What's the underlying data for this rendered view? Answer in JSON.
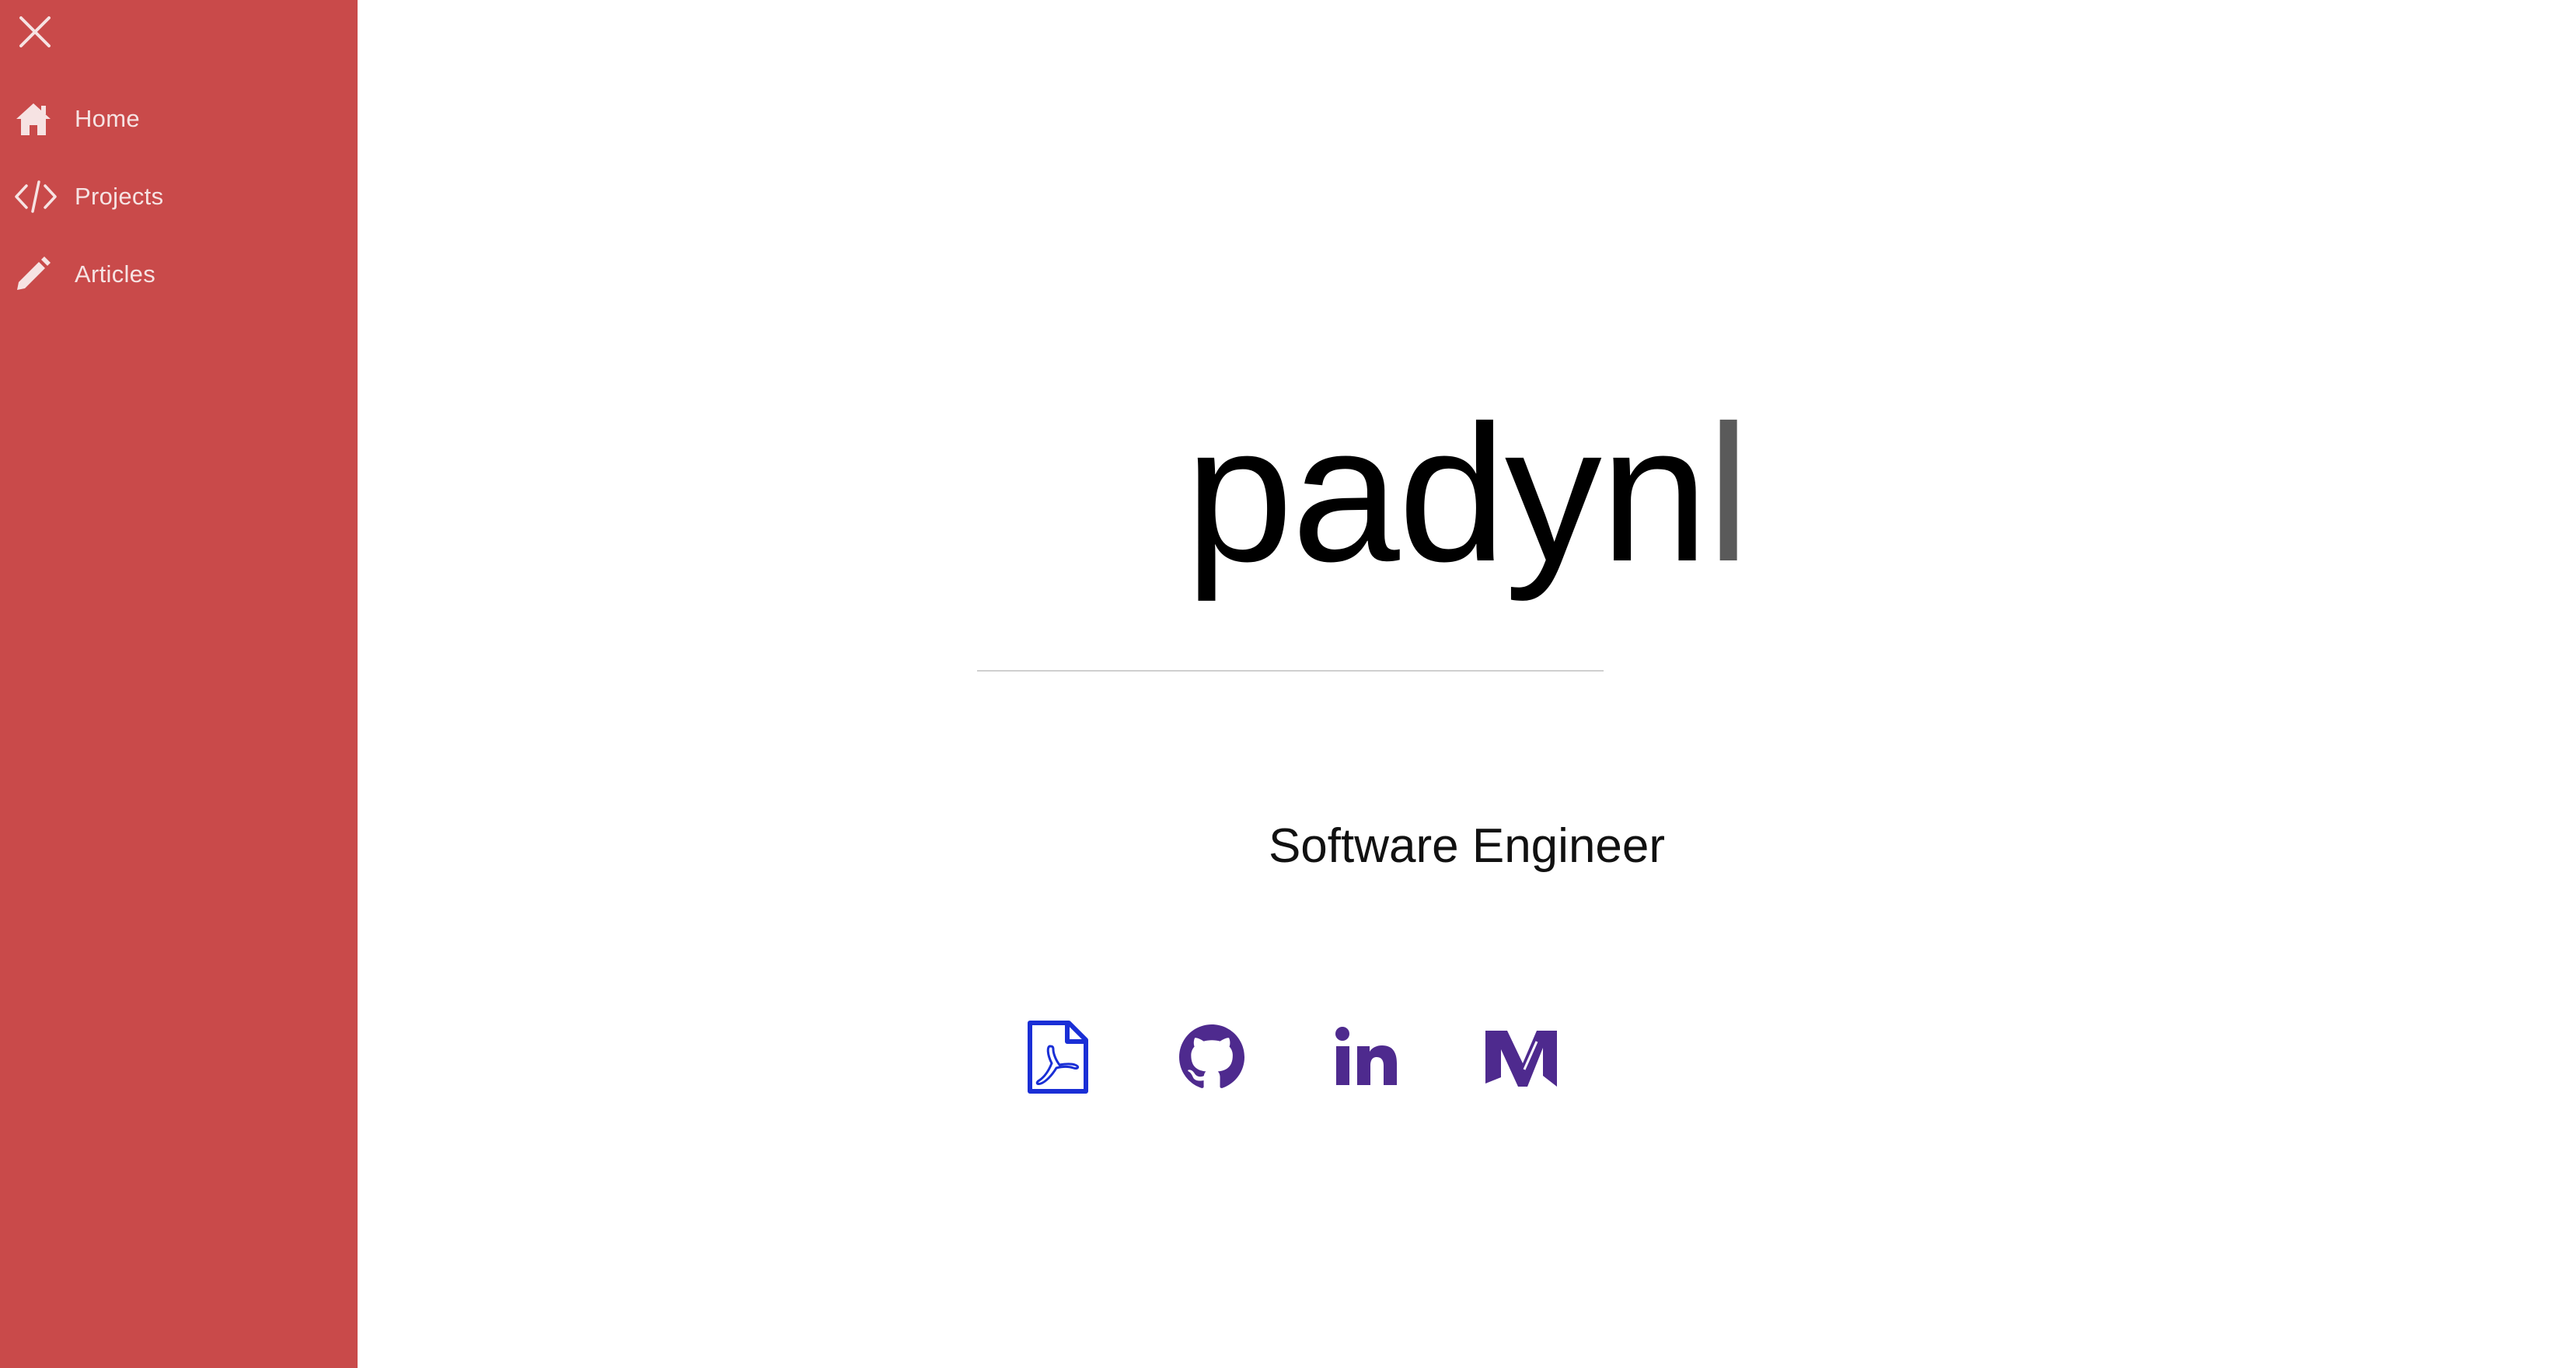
{
  "sidebar": {
    "close_icon": "close-icon",
    "items": [
      {
        "label": "Home",
        "icon": "home-icon"
      },
      {
        "label": "Projects",
        "icon": "code-icon"
      },
      {
        "label": "Articles",
        "icon": "pencil-icon"
      }
    ]
  },
  "hero": {
    "logo_text": "padyn",
    "logo_cursor": "l",
    "tagline": "Software Engineer"
  },
  "social_links": [
    {
      "icon": "pdf-resume-icon"
    },
    {
      "icon": "github-icon"
    },
    {
      "icon": "linkedin-icon"
    },
    {
      "icon": "medium-icon"
    }
  ],
  "colors": {
    "sidebar_bg": "#c94a4a",
    "sidebar_text": "#f6e3e3",
    "pdf_icon": "#1a2fd6",
    "social_icon": "#4e2a8e",
    "divider": "#cfcfcf"
  }
}
